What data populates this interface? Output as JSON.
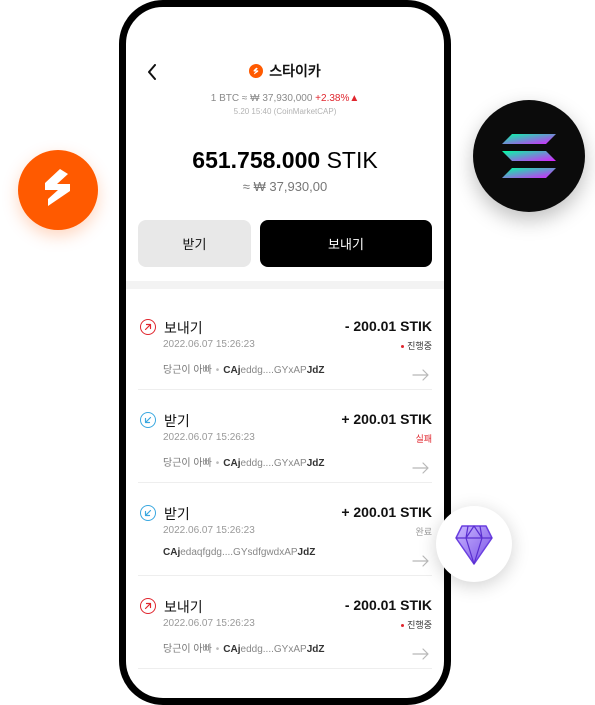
{
  "app": {
    "title": "스타이카",
    "icons": {
      "back": "chevron-left-icon",
      "title": "stik-logo-icon",
      "send": "arrow-up-right-circle-icon",
      "receive": "arrow-down-left-circle-icon",
      "detail": "arrow-right-icon"
    }
  },
  "rate": {
    "text": "1 BTC ≈ ₩ 37,930,000",
    "change": "+2.38%▲",
    "source": "5.20 15:40 (CoinMarketCAP)"
  },
  "balance": {
    "amount": "651.758.000",
    "unit": "STIK",
    "krw": "≈ ₩ 37,930,00"
  },
  "actions": {
    "receive_label": "받기",
    "send_label": "보내기"
  },
  "transactions": [
    {
      "kind": "send",
      "type": "보내기",
      "date": "2022.06.07 15:26:23",
      "amount": "- 200.01 STIK",
      "status": "진행중",
      "name": "당근이 아빠",
      "addr_head": "CAj",
      "addr_mid": "eddg....GYxAP",
      "addr_tail": "JdZ"
    },
    {
      "kind": "receive",
      "type": "받기",
      "date": "2022.06.07 15:26:23",
      "amount": "+ 200.01 STIK",
      "status": "실패",
      "name": "당근이 아빠",
      "addr_head": "CAj",
      "addr_mid": "eddg....GYxAP",
      "addr_tail": "JdZ"
    },
    {
      "kind": "receive",
      "type": "받기",
      "date": "2022.06.07 15:26:23",
      "amount": "+ 200.01 STIK",
      "status": "완료",
      "name": "",
      "addr_head": "CAj",
      "addr_mid": "edaqfgdg....GYsdfgwdxAP",
      "addr_tail": "JdZ"
    },
    {
      "kind": "send",
      "type": "보내기",
      "date": "2022.06.07 15:26:23",
      "amount": "- 200.01 STIK",
      "status": "진행중",
      "name": "당근이 아빠",
      "addr_head": "CAj",
      "addr_mid": "eddg....GYxAP",
      "addr_tail": "JdZ"
    }
  ],
  "decor": {
    "left_badge": "stik-brand-logo",
    "right_badge": "solana-logo",
    "gem_badge": "diamond-gem-logo"
  },
  "colors": {
    "brand": "#ff5a00",
    "send": "#e0262e",
    "receive": "#3aa8e0",
    "primary_button": "#000000",
    "secondary_button": "#e8e8e8"
  }
}
